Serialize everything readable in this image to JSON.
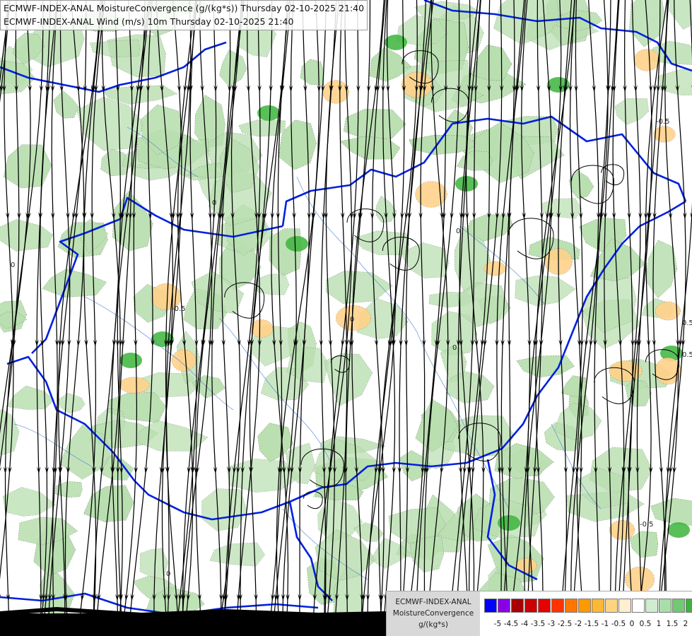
{
  "titles": {
    "line1": "ECMWF-INDEX-ANAL MoistureConvergence (g/(kg*s)) Thursday 02-10-2025 21:40",
    "line2": "ECMWF-INDEX-ANAL Wind (m/s) 10m Thursday 02-10-2025 21:40"
  },
  "legend": {
    "line1": "ECMWF-INDEX-ANAL",
    "line2": "MoistureConvergence",
    "line3": "g/(kg*s)",
    "colors": [
      "#0000ff",
      "#8a00e6",
      "#a80000",
      "#cc0000",
      "#e60000",
      "#ff3300",
      "#ff7700",
      "#ff9900",
      "#ffb833",
      "#ffd480",
      "#ffeed0",
      "#ffffff",
      "#cfeccf",
      "#a8dea8",
      "#73c873",
      "#3cb43c",
      "#00a000"
    ],
    "tick_labels": [
      "-5",
      "-4.5",
      "-4",
      "-3.5",
      "-3",
      "-2.5",
      "-2",
      "-1.5",
      "-1",
      "-0.5",
      "0",
      "0.5",
      "1",
      "1.5",
      "2"
    ]
  },
  "contour_labels": [
    "0",
    "0",
    "0",
    "0",
    "0",
    "-0.5",
    "-0.5",
    "0.5",
    "0.5",
    "-0.5",
    "0"
  ],
  "colors": {
    "border": "#0020e0",
    "rivers": "#4a7fd6",
    "streamlines": "#000000",
    "convergence_pos": "#b9dfb0",
    "convergence_strong": "#3cb43c",
    "divergence": "#ffd28a"
  }
}
